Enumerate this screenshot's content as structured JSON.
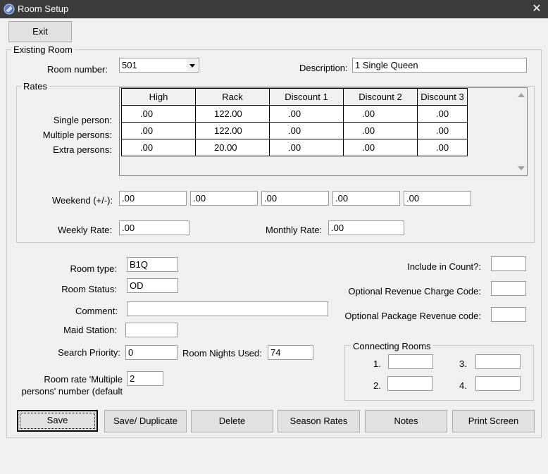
{
  "window": {
    "title": "Room Setup",
    "close_glyph": "✕"
  },
  "toolbar": {
    "exit_label": "Exit"
  },
  "existing_room": {
    "group_label": "Existing Room",
    "room_number_label": "Room number:",
    "room_number_value": "501",
    "description_label": "Description:",
    "description_value": "1 Single Queen"
  },
  "rates": {
    "group_label": "Rates",
    "columns": [
      "High",
      "Rack",
      "Discount 1",
      "Discount 2",
      "Discount 3"
    ],
    "rows": [
      {
        "label": "Single person:",
        "values": [
          ".00",
          "122.00",
          ".00",
          ".00",
          ".00"
        ]
      },
      {
        "label": "Multiple persons:",
        "values": [
          ".00",
          "122.00",
          ".00",
          ".00",
          ".00"
        ]
      },
      {
        "label": "Extra persons:",
        "values": [
          ".00",
          "20.00",
          ".00",
          ".00",
          ".00"
        ]
      }
    ],
    "weekend_label": "Weekend (+/-):",
    "weekend_values": [
      ".00",
      ".00",
      ".00",
      ".00",
      ".00"
    ],
    "weekly_label": "Weekly Rate:",
    "weekly_value": ".00",
    "monthly_label": "Monthly Rate:",
    "monthly_value": ".00"
  },
  "details": {
    "room_type_label": "Room type:",
    "room_type_value": "B1Q",
    "room_status_label": "Room Status:",
    "room_status_value": "OD",
    "comment_label": "Comment:",
    "comment_value": "",
    "maid_station_label": "Maid Station:",
    "maid_station_value": "",
    "search_priority_label": "Search Priority:",
    "search_priority_value": "0",
    "room_nights_label": "Room Nights Used:",
    "room_nights_value": "74",
    "multiple_persons_label_1": "Room rate 'Multiple",
    "multiple_persons_label_2": "persons' number (default",
    "multiple_persons_value": "2",
    "include_count_label": "Include in Count?:",
    "include_count_value": "",
    "opt_rev_charge_label": "Optional Revenue Charge Code:",
    "opt_rev_charge_value": "",
    "opt_pkg_rev_label": "Optional Package Revenue code:",
    "opt_pkg_rev_value": ""
  },
  "connecting_rooms": {
    "group_label": "Connecting Rooms",
    "items": [
      {
        "label": "1.",
        "value": ""
      },
      {
        "label": "2.",
        "value": ""
      },
      {
        "label": "3.",
        "value": ""
      },
      {
        "label": "4.",
        "value": ""
      }
    ]
  },
  "actions": {
    "save": "Save",
    "save_duplicate": "Save/ Duplicate",
    "delete": "Delete",
    "season_rates": "Season Rates",
    "notes": "Notes",
    "print_screen": "Print Screen"
  }
}
